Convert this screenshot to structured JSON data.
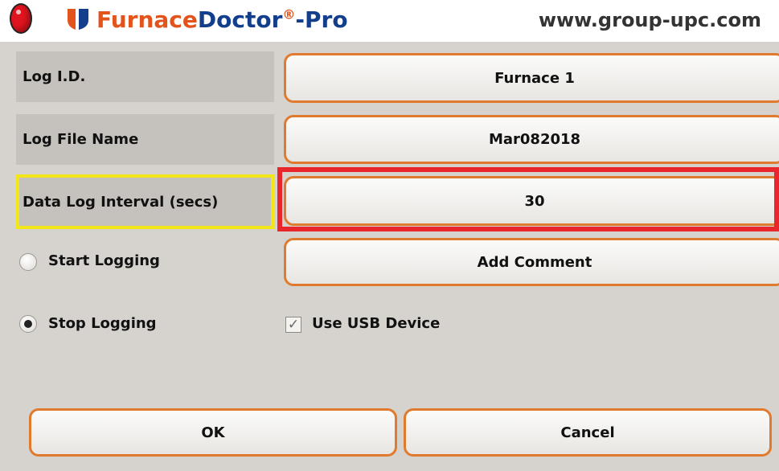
{
  "header": {
    "record_icon": "record-indicator-icon",
    "logo_icon": "shield-logo-icon",
    "brand_part1": "Furnace",
    "brand_part2": "Doctor",
    "brand_reg": "®",
    "brand_part3": "-Pro",
    "website": "www.group-upc.com"
  },
  "form": {
    "log_id": {
      "label": "Log I.D.",
      "value": "Furnace 1"
    },
    "log_file_name": {
      "label": "Log File Name",
      "value": "Mar082018"
    },
    "data_log_interval": {
      "label": "Data Log Interval (secs)",
      "value": "30"
    }
  },
  "logging": {
    "start_label": "Start Logging",
    "stop_label": "Stop Logging",
    "selected": "stop"
  },
  "add_comment_label": "Add Comment",
  "usb": {
    "label": "Use USB Device",
    "checked": true,
    "check_glyph": "✓"
  },
  "buttons": {
    "ok_label": "OK",
    "cancel_label": "Cancel"
  },
  "colors": {
    "accent_orange": "#e07a2e",
    "highlight_yellow": "#f2e619",
    "highlight_red": "#e8262c",
    "brand_orange": "#e2541c",
    "brand_blue": "#123e8c"
  }
}
